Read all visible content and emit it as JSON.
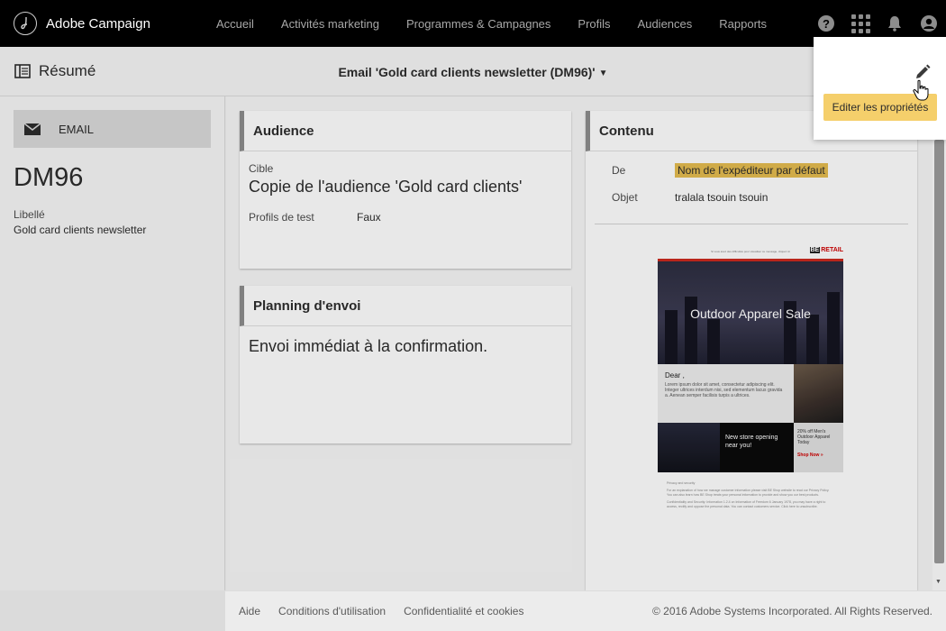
{
  "app": {
    "name": "Adobe Campaign",
    "logo_icon": "adobe-campaign-logo-icon"
  },
  "nav": {
    "items": [
      "Accueil",
      "Activités marketing",
      "Programmes & Campagnes",
      "Profils",
      "Audiences",
      "Rapports"
    ]
  },
  "top_icons": [
    "help-icon",
    "apps-grid-icon",
    "notification-bell-icon",
    "user-avatar-icon"
  ],
  "header": {
    "summary_label": "Résumé",
    "delivery_title": "Email 'Gold card clients newsletter (DM96)'"
  },
  "left": {
    "channel_label": "EMAIL",
    "code": "DM96",
    "label_caption": "Libellé",
    "label_value": "Gold card clients newsletter"
  },
  "audience": {
    "title": "Audience",
    "target_label": "Cible",
    "target_value": "Copie de l'audience 'Gold card clients'",
    "test_profiles_label": "Profils de test",
    "test_profiles_value": "Faux"
  },
  "schedule": {
    "title": "Planning d'envoi",
    "value": "Envoi immédiat à la confirmation."
  },
  "content": {
    "title": "Contenu",
    "from_label": "De",
    "from_value": "Nom de l'expéditeur par défaut",
    "subject_label": "Objet",
    "subject_value": "tralala tsouin tsouin"
  },
  "email_preview": {
    "top_line": "Si vous avez des difficultés pour visualiser ce message, cliquez ici",
    "logo_prefix": "BE",
    "logo_text": "RETAIL",
    "hero_text": "Outdoor Apparel Sale",
    "greeting": "Dear ,",
    "body": "Lorem ipsum dolor sit amet, consectetur adipiscing elit. Integer ultrices interdum nisi, sed elementum lacus gravida a. Aenean semper facilisis turpis a ultrices.",
    "store_text": "New store opening near you!",
    "offer_text": "20% off Men's Outdoor Apparel Today",
    "shop_now": "Shop Now »",
    "footer_title": "Privacy and security",
    "footer_text_1": "For an explanation of how we manage customer information please visit BE Shop website to read our Privacy Policy. You can also learn how BE Shop treats your personal information to provide and show you our best products.",
    "footer_text_2": "Confidentiality and Security: Information 1.2.4 on Information of Freedom 6 January 1978, you may have a right to access, rectify and oppose the personal data. You can contact customers service. Click here to unsubscribe."
  },
  "popover": {
    "tooltip": "Editer les propriétés"
  },
  "footer": {
    "links": [
      "Aide",
      "Conditions d'utilisation",
      "Confidentialité et cookies"
    ],
    "copyright": "© 2016 Adobe Systems Incorporated. All Rights Reserved."
  },
  "colors": {
    "topbar": "#000000",
    "tooltip": "#f5cf6b",
    "sender_highlight": "#e0b84e"
  }
}
